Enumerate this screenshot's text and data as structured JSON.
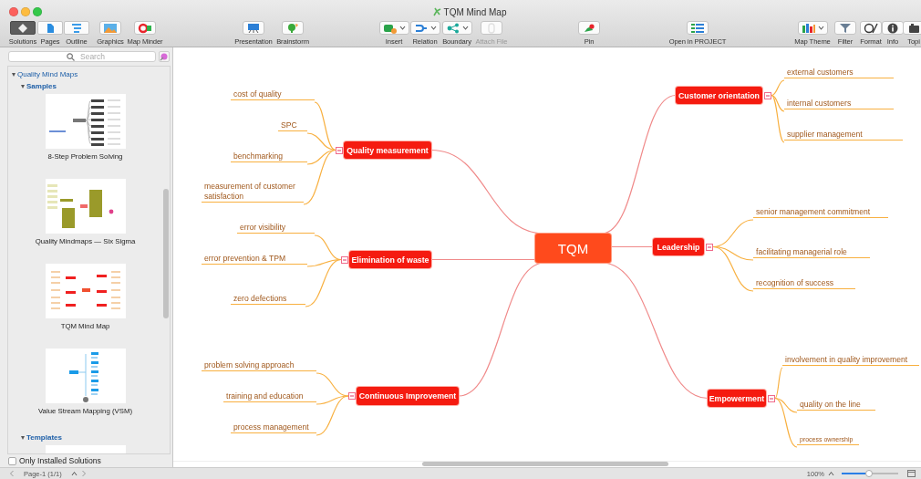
{
  "window": {
    "title": "TQM Mind Map"
  },
  "toolbar": {
    "view_switcher": [
      {
        "label": "Solutions",
        "selected": true
      },
      {
        "label": "Pages",
        "selected": false
      },
      {
        "label": "Outline",
        "selected": false
      }
    ],
    "buttons": [
      {
        "label": "Graphics",
        "dropdown": false,
        "disabled": false
      },
      {
        "label": "Map Minder",
        "dropdown": false,
        "disabled": false
      },
      {
        "label": "Presentation",
        "dropdown": false,
        "disabled": false
      },
      {
        "label": "Brainstorm",
        "dropdown": false,
        "disabled": false
      },
      {
        "label": "Insert",
        "dropdown": true,
        "disabled": false
      },
      {
        "label": "Relation",
        "dropdown": true,
        "disabled": false
      },
      {
        "label": "Boundary",
        "dropdown": true,
        "disabled": false
      },
      {
        "label": "Attach File",
        "dropdown": false,
        "disabled": true
      },
      {
        "label": "Pin",
        "dropdown": false,
        "disabled": false
      },
      {
        "label": "Open in PROJECT",
        "dropdown": false,
        "disabled": false
      },
      {
        "label": "Map Theme",
        "dropdown": true,
        "disabled": false
      },
      {
        "label": "Filter",
        "dropdown": false,
        "disabled": false
      },
      {
        "label": "Format",
        "dropdown": false,
        "disabled": false
      },
      {
        "label": "Info",
        "dropdown": false,
        "disabled": false
      },
      {
        "label": "Topi",
        "dropdown": false,
        "disabled": false
      }
    ]
  },
  "sidebar": {
    "search": {
      "placeholder": "Search"
    },
    "tree": [
      {
        "label": "Quality Mind Maps",
        "expanded": true,
        "children": [
          {
            "label": "Samples",
            "expanded": true,
            "children": [
              {
                "label": "8-Step Problem Solving",
                "kind": "tree"
              },
              {
                "label": "Quality Mindmaps — Six Sigma",
                "kind": "blocks"
              },
              {
                "label": "TQM Mind Map",
                "kind": "mindmap"
              },
              {
                "label": "Value Stream Mapping (VSM)",
                "kind": "flow"
              }
            ]
          },
          {
            "label": "Templates",
            "expanded": true,
            "children": [
              {
                "kind": "blank"
              }
            ]
          }
        ]
      }
    ],
    "only_installed": {
      "label": "Only Installed Solutions",
      "checked": false
    }
  },
  "map": {
    "central": "TQM",
    "branches": [
      {
        "label": "Quality measurement",
        "expanded": true,
        "leaves": [
          "cost of quality",
          "SPC",
          "benchmarking",
          "measurement of customer satisfaction"
        ]
      },
      {
        "label": "Elimination of waste",
        "expanded": true,
        "leaves": [
          "error visibility",
          "error prevention & TPM",
          "zero defections"
        ]
      },
      {
        "label": "Continuous Improvement",
        "expanded": true,
        "leaves": [
          "problem solving approach",
          "training and education",
          "process management"
        ]
      },
      {
        "label": "Customer orientation",
        "expanded": true,
        "leaves": [
          "external customers",
          "internal customers",
          "supplier management"
        ]
      },
      {
        "label": "Leadership",
        "expanded": true,
        "leaves": [
          "senior management commitment",
          "facilitating managerial role",
          "recognition of success"
        ]
      },
      {
        "label": "Empowerment",
        "expanded": true,
        "leaves": [
          "involvement in quality improvement",
          "quality on the line",
          "process ownership"
        ]
      }
    ]
  },
  "status_bar": {
    "page": "Page-1 (1/1)",
    "zoom": "100%",
    "zoom_slider": {
      "level": 0.48
    }
  }
}
